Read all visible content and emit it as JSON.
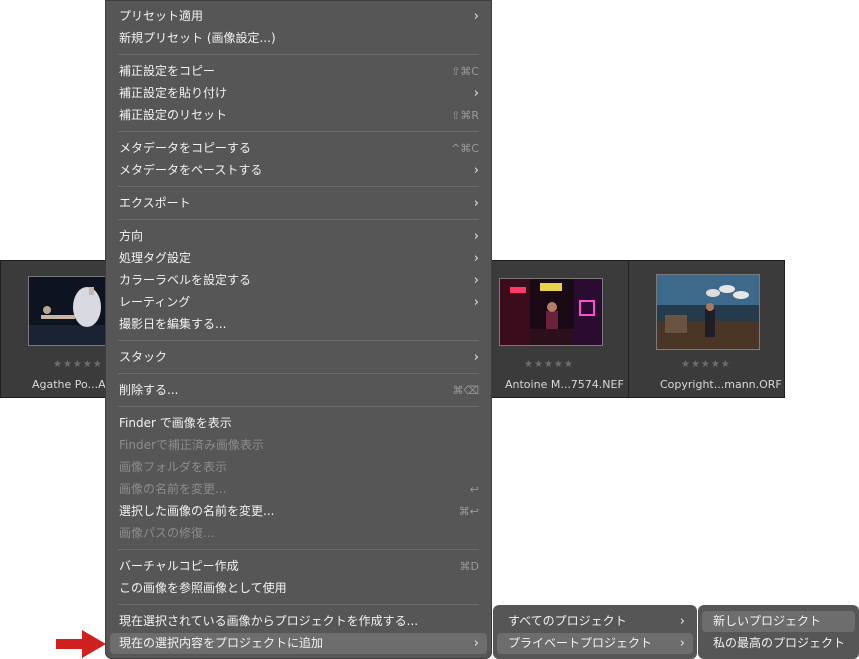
{
  "filmstrip": {
    "items": [
      {
        "filename": "Agathe Po...AC",
        "stars": "★★★★★"
      },
      {
        "filename": "Antoine M...7574.NEF",
        "stars": "★★★★★"
      },
      {
        "filename": "Copyright...mann.ORF",
        "stars": "★★★★★"
      }
    ]
  },
  "menu": {
    "items": [
      {
        "label": "プリセット適用",
        "shortcut": "",
        "submenu": true,
        "enabled": true
      },
      {
        "label": "新規プリセット (画像設定...)",
        "shortcut": "",
        "submenu": false,
        "enabled": true
      },
      {
        "label": "補正設定をコピー",
        "shortcut": "⇧⌘C",
        "submenu": false,
        "enabled": true
      },
      {
        "label": "補正設定を貼り付け",
        "shortcut": "",
        "submenu": true,
        "enabled": true
      },
      {
        "label": "補正設定のリセット",
        "shortcut": "⇧⌘R",
        "submenu": false,
        "enabled": true
      },
      {
        "label": "メタデータをコピーする",
        "shortcut": "^⌘C",
        "submenu": false,
        "enabled": true
      },
      {
        "label": "メタデータをペーストする",
        "shortcut": "",
        "submenu": true,
        "enabled": true
      },
      {
        "label": "エクスポート",
        "shortcut": "",
        "submenu": true,
        "enabled": true
      },
      {
        "label": "方向",
        "shortcut": "",
        "submenu": true,
        "enabled": true
      },
      {
        "label": "処理タグ設定",
        "shortcut": "",
        "submenu": true,
        "enabled": true
      },
      {
        "label": "カラーラベルを設定する",
        "shortcut": "",
        "submenu": true,
        "enabled": true
      },
      {
        "label": "レーティング",
        "shortcut": "",
        "submenu": true,
        "enabled": true
      },
      {
        "label": "撮影日を編集する...",
        "shortcut": "",
        "submenu": false,
        "enabled": true
      },
      {
        "label": "スタック",
        "shortcut": "",
        "submenu": true,
        "enabled": true
      },
      {
        "label": "削除する...",
        "shortcut": "⌘⌫",
        "submenu": false,
        "enabled": true
      },
      {
        "label": "Finder で画像を表示",
        "shortcut": "",
        "submenu": false,
        "enabled": true
      },
      {
        "label": "Finderで補正済み画像表示",
        "shortcut": "",
        "submenu": false,
        "enabled": false
      },
      {
        "label": "画像フォルダを表示",
        "shortcut": "",
        "submenu": false,
        "enabled": false
      },
      {
        "label": "画像の名前を変更...",
        "shortcut": "↩",
        "submenu": false,
        "enabled": false
      },
      {
        "label": "選択した画像の名前を変更...",
        "shortcut": "⌘↩",
        "submenu": false,
        "enabled": true
      },
      {
        "label": "画像パスの修復...",
        "shortcut": "",
        "submenu": false,
        "enabled": false
      },
      {
        "label": "バーチャルコピー作成",
        "shortcut": "⌘D",
        "submenu": false,
        "enabled": true
      },
      {
        "label": "この画像を参照画像として使用",
        "shortcut": "",
        "submenu": false,
        "enabled": true
      },
      {
        "label": "現在選択されている画像からプロジェクトを作成する...",
        "shortcut": "",
        "submenu": false,
        "enabled": true
      },
      {
        "label": "現在の選択内容をプロジェクトに追加",
        "shortcut": "",
        "submenu": true,
        "enabled": true
      }
    ]
  },
  "submenu1": {
    "items": [
      {
        "label": "すべてのプロジェクト",
        "submenu": true
      },
      {
        "label": "プライベートプロジェクト",
        "submenu": true
      }
    ]
  },
  "submenu2": {
    "items": [
      {
        "label": "新しいプロジェクト"
      },
      {
        "label": "私の最高のプロジェクト"
      }
    ]
  },
  "chevron": "›",
  "colors": {
    "menu_bg": "#565656",
    "highlight": "#6d6d6d",
    "arrow": "#d01f1f"
  }
}
